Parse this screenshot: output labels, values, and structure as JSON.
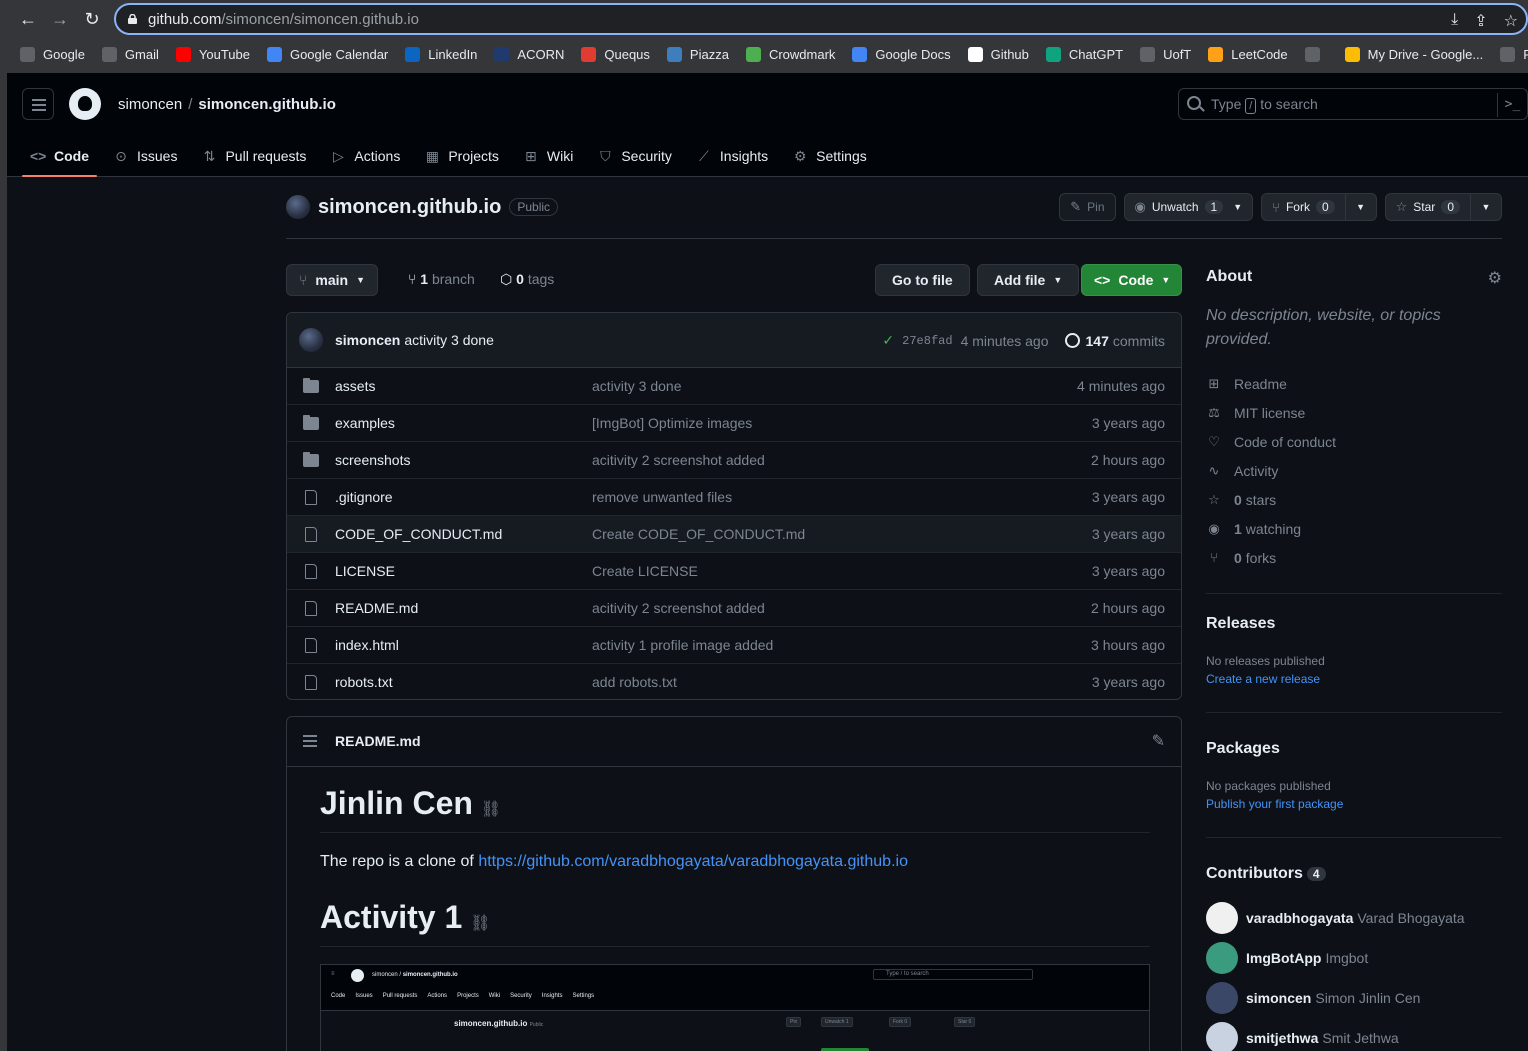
{
  "browser": {
    "url_host": "github.com",
    "url_path": "/simoncen/simoncen.github.io",
    "bookmarks": [
      {
        "label": "Google",
        "icon": "globe-icon",
        "color": "#5f6368"
      },
      {
        "label": "Gmail",
        "icon": "globe-icon",
        "color": "#5f6368"
      },
      {
        "label": "YouTube",
        "icon": "youtube-icon",
        "color": "#ff0000"
      },
      {
        "label": "Google Calendar",
        "icon": "calendar-icon",
        "color": "#4285f4"
      },
      {
        "label": "LinkedIn",
        "icon": "linkedin-icon",
        "color": "#0a66c2"
      },
      {
        "label": "ACORN",
        "icon": "acorn-icon",
        "color": "#1f3b6e"
      },
      {
        "label": "Quequs",
        "icon": "quercus-icon",
        "color": "#e03c31"
      },
      {
        "label": "Piazza",
        "icon": "piazza-icon",
        "color": "#3e7ebc"
      },
      {
        "label": "Crowdmark",
        "icon": "crowdmark-icon",
        "color": "#4caf50"
      },
      {
        "label": "Google Docs",
        "icon": "docs-icon",
        "color": "#4285f4"
      },
      {
        "label": "Github",
        "icon": "github-icon",
        "color": "#ffffff"
      },
      {
        "label": "ChatGPT",
        "icon": "chatgpt-icon",
        "color": "#10a37f"
      },
      {
        "label": "UofT",
        "icon": "folder-icon",
        "color": "#5f6368"
      },
      {
        "label": "LeetCode",
        "icon": "leetcode-icon",
        "color": "#ffa116"
      },
      {
        "label": "",
        "icon": "globe-icon",
        "color": "#5f6368"
      },
      {
        "label": "My Drive - Google...",
        "icon": "drive-icon",
        "color": "#fbbc04"
      },
      {
        "label": "RBC",
        "icon": "folder-icon",
        "color": "#5f6368"
      }
    ]
  },
  "header": {
    "owner": "simoncen",
    "repo": "simoncen.github.io",
    "search_before": "Type",
    "search_key": "/",
    "search_after": "to search",
    "cmd_symbol": ">_"
  },
  "tabs": [
    {
      "label": "Code",
      "icon": "code-icon",
      "glyph": "<>",
      "active": true
    },
    {
      "label": "Issues",
      "icon": "issue-icon",
      "glyph": "⊙",
      "active": false
    },
    {
      "label": "Pull requests",
      "icon": "pull-request-icon",
      "glyph": "⇅",
      "active": false
    },
    {
      "label": "Actions",
      "icon": "play-icon",
      "glyph": "▷",
      "active": false
    },
    {
      "label": "Projects",
      "icon": "table-icon",
      "glyph": "▦",
      "active": false
    },
    {
      "label": "Wiki",
      "icon": "book-icon",
      "glyph": "⊞",
      "active": false
    },
    {
      "label": "Security",
      "icon": "shield-icon",
      "glyph": "⛉",
      "active": false
    },
    {
      "label": "Insights",
      "icon": "graph-icon",
      "glyph": "⟋",
      "active": false
    },
    {
      "label": "Settings",
      "icon": "gear-icon",
      "glyph": "⚙",
      "active": false
    }
  ],
  "repo_header": {
    "name": "simoncen.github.io",
    "visibility": "Public",
    "pin_label": "Pin",
    "unwatch_label": "Unwatch",
    "watch_count": "1",
    "fork_label": "Fork",
    "fork_count": "0",
    "star_label": "Star",
    "star_count": "0"
  },
  "file_nav": {
    "branch": "main",
    "branch_count": "1",
    "branch_word": "branch",
    "tag_count": "0",
    "tag_word": "tags",
    "go_to_file": "Go to file",
    "add_file": "Add file",
    "code": "Code"
  },
  "latest_commit": {
    "author": "simoncen",
    "message": "activity 3 done",
    "sha": "27e8fad",
    "age": "4 minutes ago",
    "commit_count": "147",
    "commit_word": "commits"
  },
  "files": [
    {
      "name": "assets",
      "type": "dir",
      "message": "activity 3 done",
      "age": "4 minutes ago"
    },
    {
      "name": "examples",
      "type": "dir",
      "message": "[ImgBot] Optimize images",
      "age": "3 years ago"
    },
    {
      "name": "screenshots",
      "type": "dir",
      "message": "acitivity 2 screenshot added",
      "age": "2 hours ago"
    },
    {
      "name": ".gitignore",
      "type": "file",
      "message": "remove unwanted files",
      "age": "3 years ago"
    },
    {
      "name": "CODE_OF_CONDUCT.md",
      "type": "file",
      "message": "Create CODE_OF_CONDUCT.md",
      "age": "3 years ago"
    },
    {
      "name": "LICENSE",
      "type": "file",
      "message": "Create LICENSE",
      "age": "3 years ago"
    },
    {
      "name": "README.md",
      "type": "file",
      "message": "acitivity 2 screenshot added",
      "age": "2 hours ago"
    },
    {
      "name": "index.html",
      "type": "file",
      "message": "activity 1 profile image added",
      "age": "3 hours ago"
    },
    {
      "name": "robots.txt",
      "type": "file",
      "message": "add robots.txt",
      "age": "3 years ago"
    }
  ],
  "readme": {
    "filename": "README.md",
    "h1": "Jinlin Cen",
    "p_text": "The repo is a clone of",
    "p_link": "https://github.com/varadbhogayata/varadbhogayata.github.io",
    "h2": "Activity 1",
    "mini": {
      "owner": "simoncen",
      "repo": "simoncen.github.io",
      "search": "Type / to search",
      "tabs": [
        "Code",
        "Issues",
        "Pull requests",
        "Actions",
        "Projects",
        "Wiki",
        "Security",
        "Insights",
        "Settings"
      ],
      "repo_name": "simoncen.github.io",
      "visibility": "Public",
      "pin": "Pin",
      "unwatch": "Unwatch 1",
      "fork": "Fork 0",
      "star": "Star 0"
    }
  },
  "sidebar": {
    "about_title": "About",
    "about_desc": "No description, website, or topics provided.",
    "items": [
      {
        "icon": "book-icon",
        "glyph": "⊞",
        "bold": "",
        "text": "Readme"
      },
      {
        "icon": "law-icon",
        "glyph": "⚖",
        "bold": "",
        "text": "MIT license"
      },
      {
        "icon": "heart-icon",
        "glyph": "♡",
        "bold": "",
        "text": "Code of conduct"
      },
      {
        "icon": "pulse-icon",
        "glyph": "∿",
        "bold": "",
        "text": "Activity"
      },
      {
        "icon": "star-icon",
        "glyph": "☆",
        "bold": "0",
        "text": "stars"
      },
      {
        "icon": "eye-icon",
        "glyph": "◉",
        "bold": "1",
        "text": "watching"
      },
      {
        "icon": "fork-icon",
        "glyph": "⑂",
        "bold": "0",
        "text": "forks"
      }
    ],
    "releases_title": "Releases",
    "releases_none": "No releases published",
    "releases_link": "Create a new release",
    "packages_title": "Packages",
    "packages_none": "No packages published",
    "packages_link": "Publish your first package",
    "contributors_title": "Contributors",
    "contributors_count": "4",
    "contributors": [
      {
        "login": "varadbhogayata",
        "name": "Varad Bhogayata",
        "color": "#f0f0f0"
      },
      {
        "login": "ImgBotApp",
        "name": "Imgbot",
        "color": "#3a9b7e"
      },
      {
        "login": "simoncen",
        "name": "Simon Jinlin Cen",
        "color": "#3b4766"
      },
      {
        "login": "smitjethwa",
        "name": "Smit Jethwa",
        "color": "#c8d2e0"
      }
    ]
  }
}
